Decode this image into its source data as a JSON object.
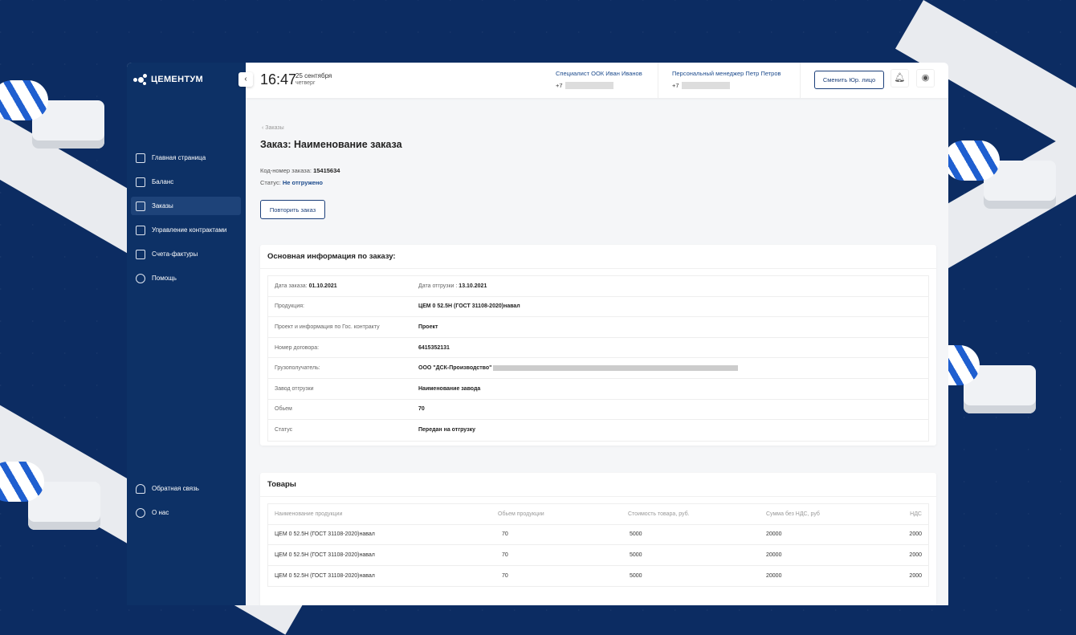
{
  "brand": "ЦЕМЕНТУМ",
  "sidebar": {
    "items": [
      {
        "label": "Главная страница",
        "icon": "home-icon"
      },
      {
        "label": "Баланс",
        "icon": "wallet-icon"
      },
      {
        "label": "Заказы",
        "icon": "cart-icon",
        "active": true
      },
      {
        "label": "Управление контрактами",
        "icon": "clipboard-icon"
      },
      {
        "label": "Счета-фактуры",
        "icon": "document-icon"
      },
      {
        "label": "Помощь",
        "icon": "lightbulb-icon"
      }
    ],
    "bottom": [
      {
        "label": "Обратная связь",
        "icon": "headset-icon"
      },
      {
        "label": "О нас",
        "icon": "info-icon"
      }
    ]
  },
  "header": {
    "time": "16:47",
    "date": "25 сентября",
    "weekday": "четверг",
    "specialist": {
      "title": "Специалист ООК Иван Иванов",
      "phone_prefix": "+7"
    },
    "manager": {
      "title": "Персональный менеджер Петр Петров",
      "phone_prefix": "+7"
    },
    "switch_label": "Сменить Юр. лицо"
  },
  "breadcrumb": "Заказы",
  "page_title": "Заказ: Наименование заказа",
  "order": {
    "code_label": "Код-номер заказа:",
    "code": "15415634",
    "status_label": "Статус:",
    "status": "Не отгружено",
    "repeat_label": "Повторить заказ"
  },
  "info": {
    "title": "Основная информация по заказу:",
    "order_date_label": "Дата заказа:",
    "order_date": "01.10.2021",
    "ship_date_label": "Дата отгрузки :",
    "ship_date": "13.10.2021",
    "rows": [
      {
        "k": "Продукция:",
        "v": "ЦЕМ 0 52.5Н (ГОСТ 31108-2020)навал"
      },
      {
        "k": "Проект и информация по Гос. контракту",
        "v": "Проект"
      },
      {
        "k": "Номер договора:",
        "v": "6415352131"
      },
      {
        "k": "Грузополучатель:",
        "v": "ООО \"ДСК-Производство\""
      },
      {
        "k": "Завод отгрузки",
        "v": "Наименование завода"
      },
      {
        "k": "Обьем",
        "v": "70"
      },
      {
        "k": "Статус",
        "v": "Передан на отгрузку"
      }
    ]
  },
  "goods": {
    "title": "Товары",
    "headers": [
      "Наименование продукции",
      "Обьем продукции",
      "Стоимость товара, руб.",
      "Сумма без НДС, руб",
      "НДС"
    ],
    "rows": [
      [
        "ЦЕМ 0 52.5Н (ГОСТ 31108-2020)навал",
        "70",
        "5000",
        "20000",
        "2000"
      ],
      [
        "ЦЕМ 0 52.5Н (ГОСТ 31108-2020)навал",
        "70",
        "5000",
        "20000",
        "2000"
      ],
      [
        "ЦЕМ 0 52.5Н (ГОСТ 31108-2020)навал",
        "70",
        "5000",
        "20000",
        "2000"
      ]
    ]
  }
}
